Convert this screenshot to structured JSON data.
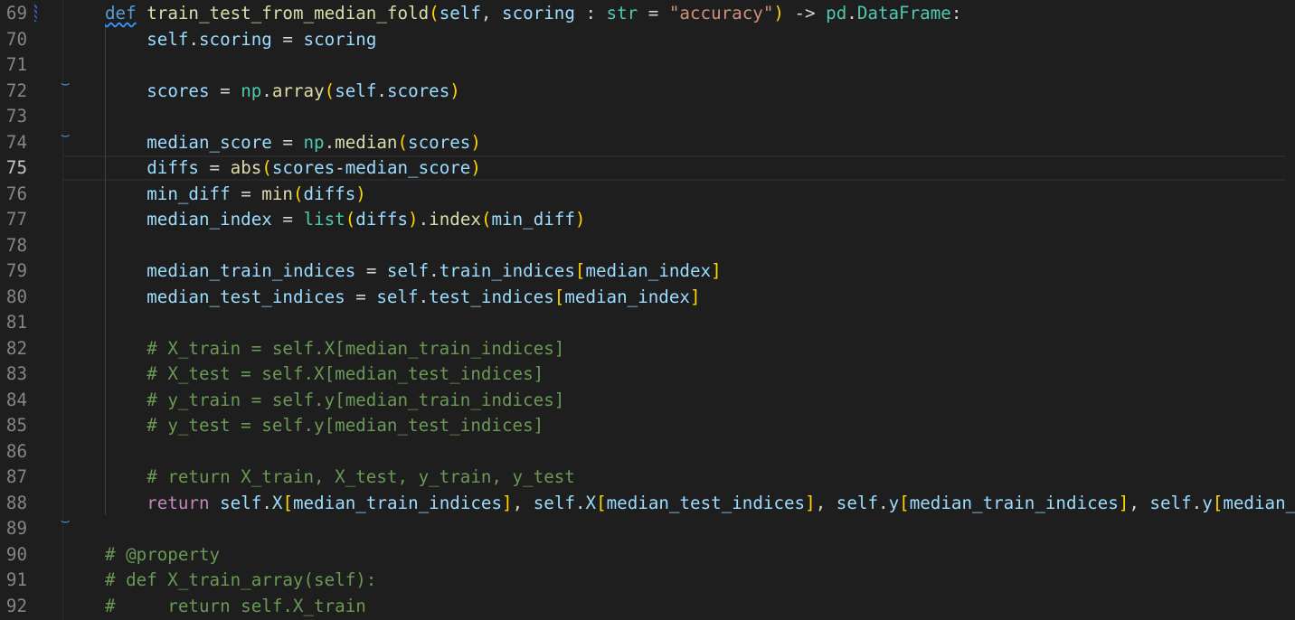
{
  "editor": {
    "active_line": 75,
    "lines": [
      {
        "number": "69",
        "tokens": [
          {
            "t": "def",
            "c": "k"
          },
          {
            "t": " "
          },
          {
            "t": "train_test_from_median_fold",
            "c": "fn"
          },
          {
            "t": "(",
            "c": "p1"
          },
          {
            "t": "self",
            "c": "v"
          },
          {
            "t": ", "
          },
          {
            "t": "scoring",
            "c": "v"
          },
          {
            "t": " : "
          },
          {
            "t": "str",
            "c": "cls"
          },
          {
            "t": " = "
          },
          {
            "t": "\"accuracy\"",
            "c": "s"
          },
          {
            "t": ")",
            "c": "p1"
          },
          {
            "t": " -> "
          },
          {
            "t": "pd",
            "c": "cls"
          },
          {
            "t": "."
          },
          {
            "t": "DataFrame",
            "c": "cls"
          },
          {
            "t": ":"
          }
        ]
      },
      {
        "number": "70",
        "tokens": [
          {
            "t": "    "
          },
          {
            "t": "self",
            "c": "v"
          },
          {
            "t": "."
          },
          {
            "t": "scoring",
            "c": "v"
          },
          {
            "t": " = "
          },
          {
            "t": "scoring",
            "c": "v"
          }
        ]
      },
      {
        "number": "71",
        "tokens": []
      },
      {
        "number": "72",
        "tokens": [
          {
            "t": "    "
          },
          {
            "t": "scores",
            "c": "v"
          },
          {
            "t": " = "
          },
          {
            "t": "np",
            "c": "cls"
          },
          {
            "t": "."
          },
          {
            "t": "array",
            "c": "fn"
          },
          {
            "t": "(",
            "c": "p1"
          },
          {
            "t": "self",
            "c": "v"
          },
          {
            "t": "."
          },
          {
            "t": "scores",
            "c": "v"
          },
          {
            "t": ")",
            "c": "p1"
          }
        ]
      },
      {
        "number": "73",
        "tokens": []
      },
      {
        "number": "74",
        "tokens": [
          {
            "t": "    "
          },
          {
            "t": "median_score",
            "c": "v"
          },
          {
            "t": " = "
          },
          {
            "t": "np",
            "c": "cls"
          },
          {
            "t": "."
          },
          {
            "t": "median",
            "c": "fn"
          },
          {
            "t": "(",
            "c": "p1"
          },
          {
            "t": "scores",
            "c": "v"
          },
          {
            "t": ")",
            "c": "p1"
          }
        ]
      },
      {
        "number": "75",
        "tokens": [
          {
            "t": "    "
          },
          {
            "t": "diffs",
            "c": "v"
          },
          {
            "t": " = "
          },
          {
            "t": "abs",
            "c": "fn"
          },
          {
            "t": "(",
            "c": "p1"
          },
          {
            "t": "scores",
            "c": "v"
          },
          {
            "t": "-"
          },
          {
            "t": "median_score",
            "c": "v"
          },
          {
            "t": ")",
            "c": "p1"
          }
        ]
      },
      {
        "number": "76",
        "tokens": [
          {
            "t": "    "
          },
          {
            "t": "min_diff",
            "c": "v"
          },
          {
            "t": " = "
          },
          {
            "t": "min",
            "c": "fn"
          },
          {
            "t": "(",
            "c": "p1"
          },
          {
            "t": "diffs",
            "c": "v"
          },
          {
            "t": ")",
            "c": "p1"
          }
        ]
      },
      {
        "number": "77",
        "tokens": [
          {
            "t": "    "
          },
          {
            "t": "median_index",
            "c": "v"
          },
          {
            "t": " = "
          },
          {
            "t": "list",
            "c": "cls"
          },
          {
            "t": "(",
            "c": "p1"
          },
          {
            "t": "diffs",
            "c": "v"
          },
          {
            "t": ")",
            "c": "p1"
          },
          {
            "t": "."
          },
          {
            "t": "index",
            "c": "fn"
          },
          {
            "t": "(",
            "c": "p1"
          },
          {
            "t": "min_diff",
            "c": "v"
          },
          {
            "t": ")",
            "c": "p1"
          }
        ]
      },
      {
        "number": "78",
        "tokens": []
      },
      {
        "number": "79",
        "tokens": [
          {
            "t": "    "
          },
          {
            "t": "median_train_indices",
            "c": "v"
          },
          {
            "t": " = "
          },
          {
            "t": "self",
            "c": "v"
          },
          {
            "t": "."
          },
          {
            "t": "train_indices",
            "c": "v"
          },
          {
            "t": "[",
            "c": "p1"
          },
          {
            "t": "median_index",
            "c": "v"
          },
          {
            "t": "]",
            "c": "p1"
          }
        ]
      },
      {
        "number": "80",
        "tokens": [
          {
            "t": "    "
          },
          {
            "t": "median_test_indices",
            "c": "v"
          },
          {
            "t": " = "
          },
          {
            "t": "self",
            "c": "v"
          },
          {
            "t": "."
          },
          {
            "t": "test_indices",
            "c": "v"
          },
          {
            "t": "[",
            "c": "p1"
          },
          {
            "t": "median_index",
            "c": "v"
          },
          {
            "t": "]",
            "c": "p1"
          }
        ]
      },
      {
        "number": "81",
        "tokens": []
      },
      {
        "number": "82",
        "tokens": [
          {
            "t": "    "
          },
          {
            "t": "# X_train = self.X[median_train_indices]",
            "c": "c"
          }
        ]
      },
      {
        "number": "83",
        "tokens": [
          {
            "t": "    "
          },
          {
            "t": "# X_test = self.X[median_test_indices]",
            "c": "c"
          }
        ]
      },
      {
        "number": "84",
        "tokens": [
          {
            "t": "    "
          },
          {
            "t": "# y_train = self.y[median_train_indices]",
            "c": "c"
          }
        ]
      },
      {
        "number": "85",
        "tokens": [
          {
            "t": "    "
          },
          {
            "t": "# y_test = self.y[median_test_indices]",
            "c": "c"
          }
        ]
      },
      {
        "number": "86",
        "tokens": []
      },
      {
        "number": "87",
        "tokens": [
          {
            "t": "    "
          },
          {
            "t": "# return X_train, X_test, y_train, y_test",
            "c": "c"
          }
        ]
      },
      {
        "number": "88",
        "tokens": [
          {
            "t": "    "
          },
          {
            "t": "return",
            "c": "ctl"
          },
          {
            "t": " "
          },
          {
            "t": "self",
            "c": "v"
          },
          {
            "t": "."
          },
          {
            "t": "X",
            "c": "v"
          },
          {
            "t": "[",
            "c": "p1"
          },
          {
            "t": "median_train_indices",
            "c": "v"
          },
          {
            "t": "]",
            "c": "p1"
          },
          {
            "t": ", "
          },
          {
            "t": "self",
            "c": "v"
          },
          {
            "t": "."
          },
          {
            "t": "X",
            "c": "v"
          },
          {
            "t": "[",
            "c": "p1"
          },
          {
            "t": "median_test_indices",
            "c": "v"
          },
          {
            "t": "]",
            "c": "p1"
          },
          {
            "t": ", "
          },
          {
            "t": "self",
            "c": "v"
          },
          {
            "t": "."
          },
          {
            "t": "y",
            "c": "v"
          },
          {
            "t": "[",
            "c": "p1"
          },
          {
            "t": "median_train_indices",
            "c": "v"
          },
          {
            "t": "]",
            "c": "p1"
          },
          {
            "t": ", "
          },
          {
            "t": "self",
            "c": "v"
          },
          {
            "t": "."
          },
          {
            "t": "y",
            "c": "v"
          },
          {
            "t": "[",
            "c": "p1"
          },
          {
            "t": "median_",
            "c": "v"
          }
        ]
      },
      {
        "number": "89",
        "tokens": []
      },
      {
        "number": "90",
        "tokens": [
          {
            "t": "# @property",
            "c": "c"
          }
        ]
      },
      {
        "number": "91",
        "tokens": [
          {
            "t": "# def X_train_array(self):",
            "c": "c"
          }
        ]
      },
      {
        "number": "92",
        "tokens": [
          {
            "t": "#     return self.X_train",
            "c": "c"
          }
        ]
      }
    ]
  }
}
